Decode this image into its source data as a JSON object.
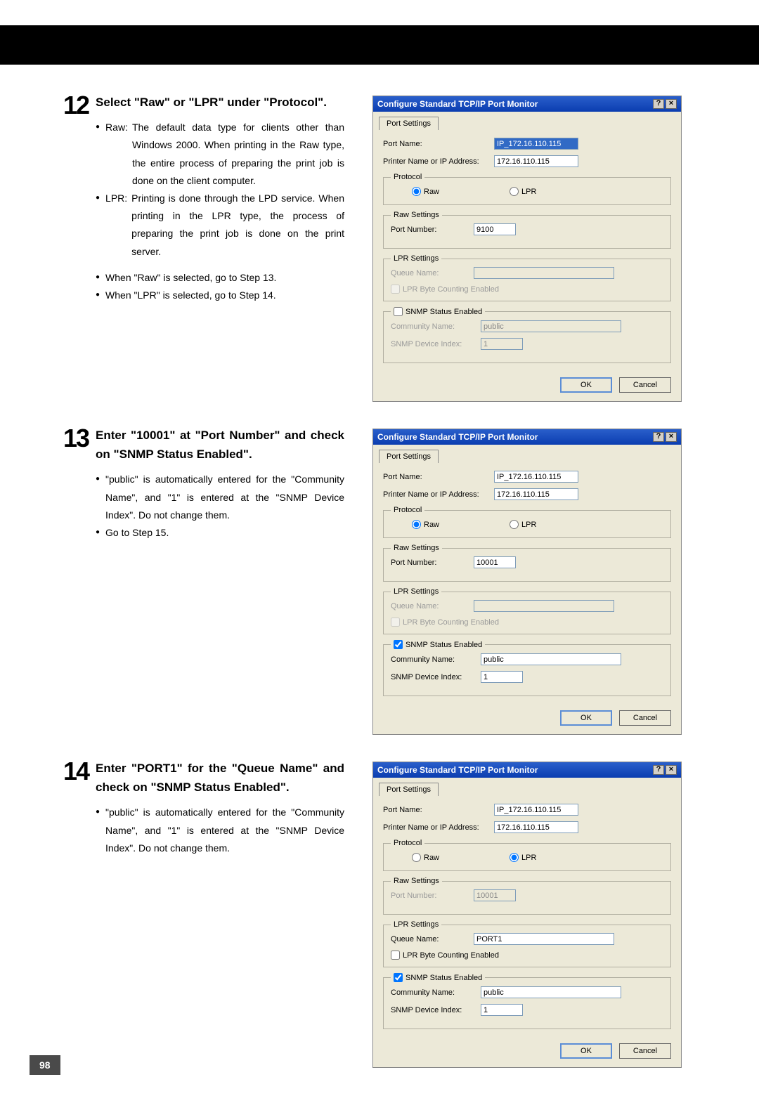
{
  "pageNumber": "98",
  "step12": {
    "num": "12",
    "title": "Select \"Raw\" or \"LPR\" under \"Protocol\".",
    "raw_term": "Raw:",
    "raw_desc": "The default data type for clients other than Windows 2000.  When printing in the Raw type, the entire process of preparing the print job is done on the client computer.",
    "lpr_term": "LPR:",
    "lpr_desc": "Printing is done through the LPD service. When printing in the LPR type, the process of preparing the print job is done on the print server.",
    "note1": "When \"Raw\" is selected, go to Step 13.",
    "note2": "When \"LPR\" is selected, go to Step 14."
  },
  "step13": {
    "num": "13",
    "title": "Enter \"10001\" at \"Port Number\" and check on \"SNMP Status Enabled\".",
    "b1": "\"public\" is automatically entered for the \"Community Name\", and \"1\" is entered at the \"SNMP Device Index\".  Do not change them.",
    "b2": "Go to Step 15."
  },
  "step14": {
    "num": "14",
    "title": "Enter \"PORT1\" for the \"Queue Name\" and check on \"SNMP Status Enabled\".",
    "b1": "\"public\" is automatically entered for the \"Community Name\", and \"1\" is entered at the \"SNMP Device Index\".  Do not change them."
  },
  "dialog": {
    "title": "Configure Standard TCP/IP Port Monitor",
    "tab": "Port Settings",
    "portName_lbl": "Port Name:",
    "printer_lbl": "Printer Name or IP Address:",
    "protocol_lbl": "Protocol",
    "raw": "Raw",
    "lpr": "LPR",
    "rawSettings": "Raw Settings",
    "portNum_lbl": "Port Number:",
    "lprSettings": "LPR Settings",
    "queue_lbl": "Queue Name:",
    "byteCounting": "LPR Byte Counting Enabled",
    "snmp": "SNMP Status Enabled",
    "community_lbl": "Community Name:",
    "devIndex_lbl": "SNMP Device Index:",
    "ok": "OK",
    "cancel": "Cancel",
    "help": "?",
    "close": "×"
  },
  "d1": {
    "portName": "IP_172.16.110.115",
    "printer": "172.16.110.115",
    "portNum": "9100",
    "queue": "",
    "community": "public",
    "devIndex": "1"
  },
  "d2": {
    "portName": "IP_172.16.110.115",
    "printer": "172.16.110.115",
    "portNum": "10001",
    "queue": "",
    "community": "public",
    "devIndex": "1"
  },
  "d3": {
    "portName": "IP_172.16.110.115",
    "printer": "172.16.110.115",
    "portNum": "10001",
    "queue": "PORT1",
    "community": "public",
    "devIndex": "1"
  }
}
